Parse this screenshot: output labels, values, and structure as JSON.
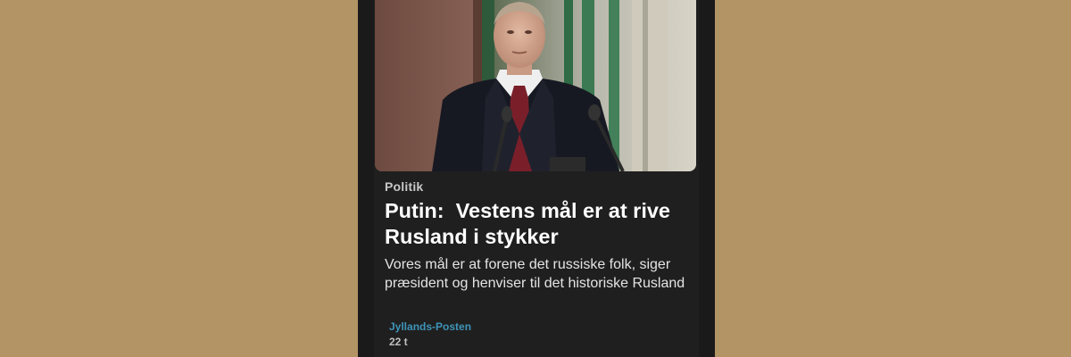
{
  "article": {
    "category": "Politik",
    "headline": "Putin:  Vestens mål er at rive Rusland i stykker",
    "summary": "Vores mål er at forene det russiske folk, siger præsident og henviser til det historiske Rusland",
    "source": "Jyllands-Posten",
    "time": "22 t"
  },
  "colors": {
    "page_background": "#b39465",
    "card_background": "#1f1f1f",
    "headline": "#ffffff",
    "category": "#c8c8c8",
    "source_link": "#3e94b8"
  },
  "icons": [
    "article-photo"
  ]
}
